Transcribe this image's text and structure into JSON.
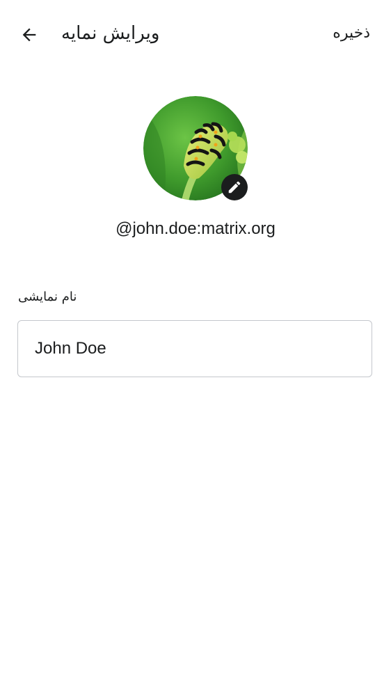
{
  "header": {
    "title": "ویرایش نمایه",
    "save_label": "ذخیره",
    "back_icon": "arrow-back-icon"
  },
  "profile": {
    "avatar_icon": "avatar-caterpillar-photo",
    "edit_icon": "pencil-icon",
    "user_id": "@john.doe:matrix.org"
  },
  "form": {
    "display_name_label": "نام نمایشی",
    "display_name_value": "John Doe"
  },
  "colors": {
    "text": "#1b1d1e",
    "field_border": "#c4c7cc",
    "badge_bg": "#1b1d1e"
  }
}
